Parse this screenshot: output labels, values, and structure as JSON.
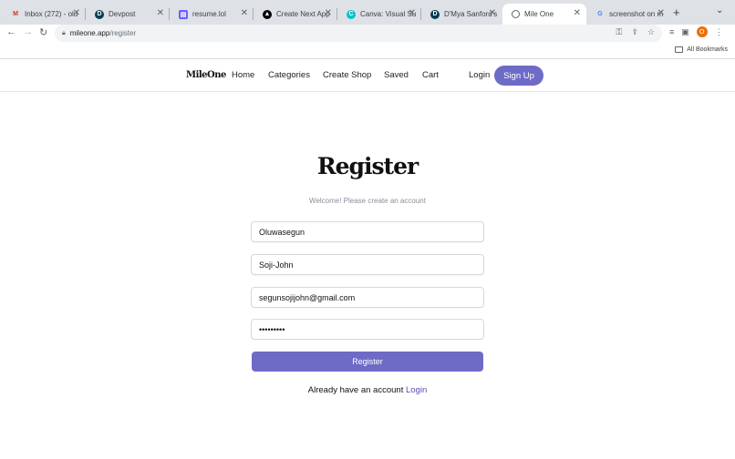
{
  "browser": {
    "tabs": [
      {
        "title": "Inbox (272) - olu",
        "icon": "gmail-icon",
        "icon_color": "#d93025"
      },
      {
        "title": "Devpost",
        "icon": "devpost-icon",
        "icon_color": "#003e54"
      },
      {
        "title": "resume.lol",
        "icon": "document-icon",
        "icon_color": "#6d5dfc"
      },
      {
        "title": "Create Next App",
        "icon": "nextjs-icon",
        "icon_color": "#000000"
      },
      {
        "title": "Canva: Visual Su",
        "icon": "canva-icon",
        "icon_color": "#00c4cc"
      },
      {
        "title": "D'Mya Sanford's",
        "icon": "devpost-icon",
        "icon_color": "#003e54"
      },
      {
        "title": "Mile One",
        "icon": "globe-icon",
        "icon_color": "#5f6368",
        "active": true
      },
      {
        "title": "screenshot on m",
        "icon": "google-icon",
        "icon_color": "#4285f4"
      }
    ],
    "new_tab": "+",
    "url_host": "mileone.app",
    "url_path": "/register",
    "profile_initial": "O",
    "bookmarks_label": "All Bookmarks"
  },
  "site": {
    "logo": "MileOne",
    "nav": [
      "Home",
      "Categories",
      "Create Shop",
      "Saved",
      "Cart"
    ],
    "login": "Login",
    "signup": "Sign Up",
    "accent": "#6e6bc7"
  },
  "form": {
    "heading": "Register",
    "subtitle": "Welcome! Please create an account",
    "first_name": "Oluwasegun",
    "last_name": "Soji-John",
    "email": "segunsojijohn@gmail.com",
    "password_masked": "•••••••••",
    "submit": "Register",
    "already_text": "Already have an account",
    "login_link": "Login"
  }
}
